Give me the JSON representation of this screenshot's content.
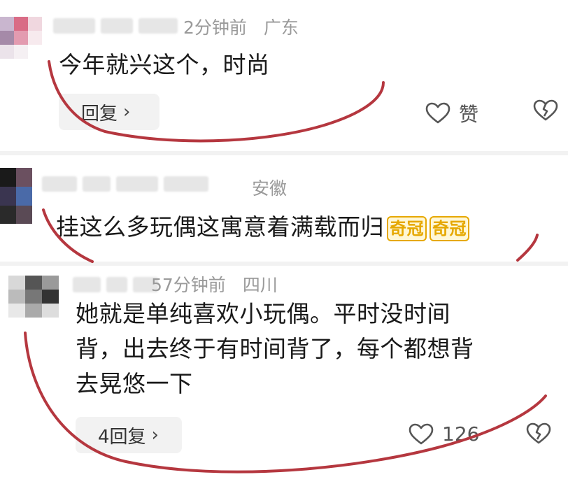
{
  "comments": [
    {
      "username_hidden": true,
      "time": "2分钟前",
      "location": "广东",
      "text_lines": [
        "今年就兴这个，时尚"
      ],
      "reply_label": "回复",
      "like_label": "赞",
      "icons": [
        "heart-icon",
        "broken-heart-icon"
      ]
    },
    {
      "username_hidden": true,
      "time": "",
      "location": "安徽",
      "text_lines": [
        "挂这么多玩偶这寓意着满载而归"
      ],
      "stickers": [
        "奇冠",
        "奇冠"
      ],
      "icons": []
    },
    {
      "username_hidden": true,
      "time": "57分钟前",
      "location": "四川",
      "text_lines": [
        "她就是单纯喜欢小玩偶。平时没时间",
        "背，出去终于有时间背了，每个都想背",
        "去晃悠一下"
      ],
      "reply_label": "4回复",
      "like_count": "126",
      "icons": [
        "heart-icon",
        "broken-heart-icon"
      ]
    }
  ],
  "colors": {
    "scribble": "#b5373f",
    "meta_text": "#9a9a9a",
    "body_text": "#1a1a1a",
    "reply_bg": "#f2f2f2",
    "sticker": "#e6a800"
  }
}
